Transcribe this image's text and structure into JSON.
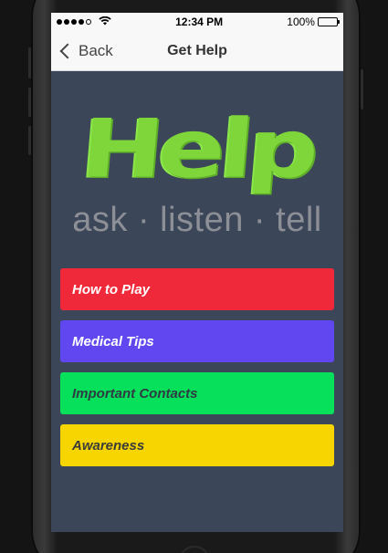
{
  "status": {
    "time": "12:34 PM",
    "battery": "100%",
    "signal_bars_filled": 4,
    "signal_bars_total": 5
  },
  "nav": {
    "back_label": "Back",
    "title": "Get Help"
  },
  "logo": {
    "word": "Help",
    "tagline": "ask · listen · tell"
  },
  "menu": [
    {
      "label": "How to Play",
      "bg": "#f0293a",
      "fg": "#ffffff"
    },
    {
      "label": "Medical Tips",
      "bg": "#6047f0",
      "fg": "#ffffff"
    },
    {
      "label": "Important Contacts",
      "bg": "#06e05a",
      "fg": "#2f3b44"
    },
    {
      "label": "Awareness",
      "bg": "#f6d500",
      "fg": "#3b3b3b"
    }
  ],
  "colors": {
    "screen_bg": "#3c4659",
    "logo_green": "#7ed63b"
  }
}
